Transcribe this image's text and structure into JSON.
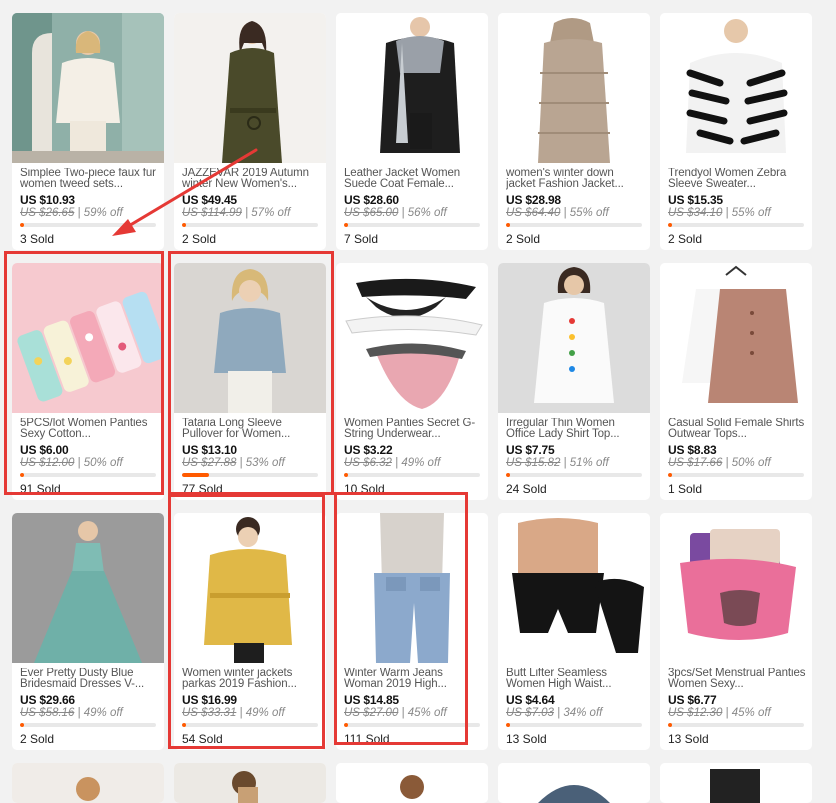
{
  "products": [
    {
      "title": "Simplee Two-piece faux fur women tweed sets...",
      "price": "US $10.93",
      "original": "US $26.65",
      "discount": "59% off",
      "sold": "3 Sold",
      "sold_fraction": 0.02
    },
    {
      "title": "JAZZEVAR 2019 Autumn winter New Women's...",
      "price": "US $49.45",
      "original": "US $114.99",
      "discount": "57% off",
      "sold": "2 Sold",
      "sold_fraction": 0.02
    },
    {
      "title": "Leather Jacket Women Suede Coat Female...",
      "price": "US $28.60",
      "original": "US $65.00",
      "discount": "56% off",
      "sold": "7 Sold",
      "sold_fraction": 0.02
    },
    {
      "title": "women's winter down jacket Fashion Jacket...",
      "price": "US $28.98",
      "original": "US $64.40",
      "discount": "55% off",
      "sold": "2 Sold",
      "sold_fraction": 0.02
    },
    {
      "title": "Trendyol Women Zebra Sleeve Sweater...",
      "price": "US $15.35",
      "original": "US $34.10",
      "discount": "55% off",
      "sold": "2 Sold",
      "sold_fraction": 0.02
    },
    {
      "title": "5PCS/lot Women Panties Sexy Cotton...",
      "price": "US $6.00",
      "original": "US $12.00",
      "discount": "50% off",
      "sold": "91 Sold",
      "sold_fraction": 0.02
    },
    {
      "title": "Tataria Long Sleeve Pullover for Women...",
      "price": "US $13.10",
      "original": "US $27.88",
      "discount": "53% off",
      "sold": "77 Sold",
      "sold_fraction": 0.2
    },
    {
      "title": "Women Panties Secret G-String Underwear...",
      "price": "US $3.22",
      "original": "US $6.32",
      "discount": "49% off",
      "sold": "10 Sold",
      "sold_fraction": 0.02
    },
    {
      "title": "Irregular Thin Women Office Lady Shirt Top...",
      "price": "US $7.75",
      "original": "US $15.82",
      "discount": "51% off",
      "sold": "24 Sold",
      "sold_fraction": 0.02
    },
    {
      "title": "Casual Solid Female Shirts Outwear Tops...",
      "price": "US $8.83",
      "original": "US $17.66",
      "discount": "50% off",
      "sold": "1 Sold",
      "sold_fraction": 0.02
    },
    {
      "title": "Ever Pretty Dusty Blue Bridesmaid Dresses V-...",
      "price": "US $29.66",
      "original": "US $58.16",
      "discount": "49% off",
      "sold": "2 Sold",
      "sold_fraction": 0.02
    },
    {
      "title": "Women winter jackets parkas 2019 Fashion...",
      "price": "US $16.99",
      "original": "US $33.31",
      "discount": "49% off",
      "sold": "54 Sold",
      "sold_fraction": 0.02
    },
    {
      "title": "Winter Warm Jeans Woman 2019 High...",
      "price": "US $14.85",
      "original": "US $27.00",
      "discount": "45% off",
      "sold": "111 Sold",
      "sold_fraction": 0.02
    },
    {
      "title": "Butt Lifter Seamless Women High Waist...",
      "price": "US $4.64",
      "original": "US $7.03",
      "discount": "34% off",
      "sold": "13 Sold",
      "sold_fraction": 0.02
    },
    {
      "title": "3pcs/Set Menstrual Panties Women Sexy...",
      "price": "US $6.77",
      "original": "US $12.30",
      "discount": "45% off",
      "sold": "13 Sold",
      "sold_fraction": 0.02
    }
  ],
  "colors": {
    "background": "#f2f2f2",
    "card": "#ffffff",
    "highlight": "#e53935",
    "progress": "#ff5a00",
    "price": "#111111"
  },
  "image_subjects": [
    "woman-white-faux-fur-jacket",
    "woman-olive-belted-coat",
    "leather-jacket-with-fur-collar",
    "beige-long-puffer-coat",
    "zebra-stripe-sweater",
    "pastel-panties-pack",
    "woman-light-blue-pullover",
    "black-white-pink-panties",
    "white-shirt-with-colored-buttons",
    "pink-blouse-on-hanger",
    "teal-tulle-gown",
    "woman-yellow-puffer-jacket",
    "fleece-lined-jeans",
    "black-shapewear-shorts",
    "pink-menstrual-panties"
  ]
}
